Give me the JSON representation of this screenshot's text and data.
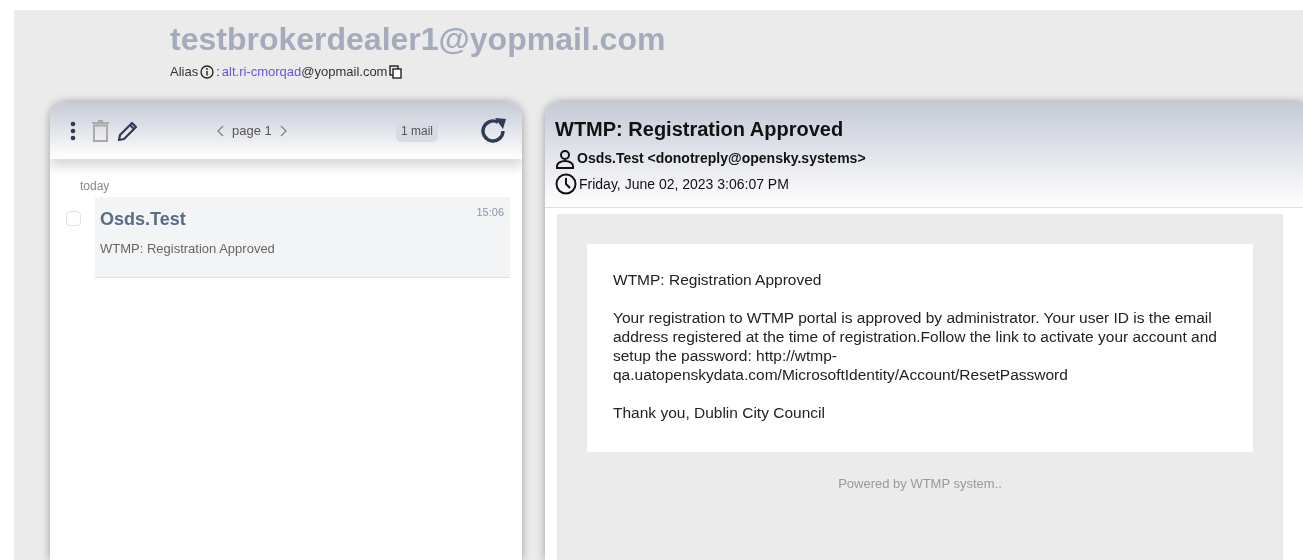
{
  "account": {
    "email": "testbrokerdealer1@yopmail.com",
    "alias_label": "Alias",
    "alias_separator": ":",
    "alias_user": "alt.ri-cmorqad",
    "alias_domain": "@yopmail.com"
  },
  "inbox": {
    "pager": "page 1",
    "count": "1 mail",
    "group": "today",
    "messages": [
      {
        "sender": "Osds.Test",
        "subject": "WTMP: Registration Approved",
        "time": "15:06",
        "checked": false,
        "selected": true
      }
    ]
  },
  "message": {
    "subject": "WTMP: Registration Approved",
    "from": "Osds.Test <donotreply@opensky.systems>",
    "date": "Friday, June 02, 2023 3:06:07 PM",
    "body": [
      "WTMP: Registration Approved",
      "Your registration to WTMP portal is approved by administrator. Your user ID is the email address registered at the time of registration.Follow the link to activate your account and setup the password: http://wtmp-qa.uatopenskydata.com/MicrosoftIdentity/Account/ResetPassword",
      "Thank you, Dublin City Council"
    ],
    "footer": "Powered by WTMP system.."
  }
}
